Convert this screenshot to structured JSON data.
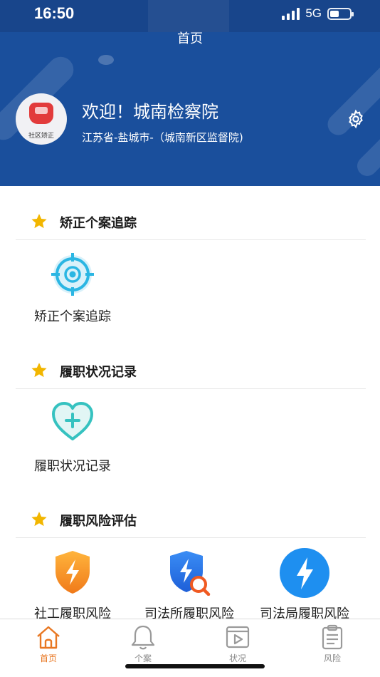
{
  "status_bar": {
    "time": "16:50",
    "network": "5G"
  },
  "header": {
    "title": "首页",
    "avatar_caption": "社区矫正",
    "welcome": "欢迎！城南检察院",
    "location": "江苏省-盐城市-（城南新区监督院)"
  },
  "sections": [
    {
      "title": "矫正个案追踪",
      "items": [
        {
          "label": "矫正个案追踪",
          "icon": "target-icon"
        }
      ]
    },
    {
      "title": "履职状况记录",
      "items": [
        {
          "label": "履职状况记录",
          "icon": "heart-plus-icon"
        }
      ]
    },
    {
      "title": "履职风险评估",
      "items": [
        {
          "label": "社工履职风险",
          "icon": "orange-shield-bolt-icon"
        },
        {
          "label": "司法所履职风险",
          "icon": "blue-shield-search-icon"
        },
        {
          "label": "司法局履职风险",
          "icon": "blue-bolt-circle-icon"
        }
      ]
    }
  ],
  "tabbar": {
    "tabs": [
      {
        "label": "首页",
        "icon": "home-icon",
        "active": true
      },
      {
        "label": "个案",
        "icon": "bell-icon",
        "active": false
      },
      {
        "label": "状况",
        "icon": "video-icon",
        "active": false
      },
      {
        "label": "风险",
        "icon": "clipboard-icon",
        "active": false
      }
    ]
  },
  "colors": {
    "header_bg": "#1a4f9c",
    "accent_orange": "#e87722",
    "star_yellow": "#f2b600",
    "tab_inactive": "#8a8a8a"
  }
}
